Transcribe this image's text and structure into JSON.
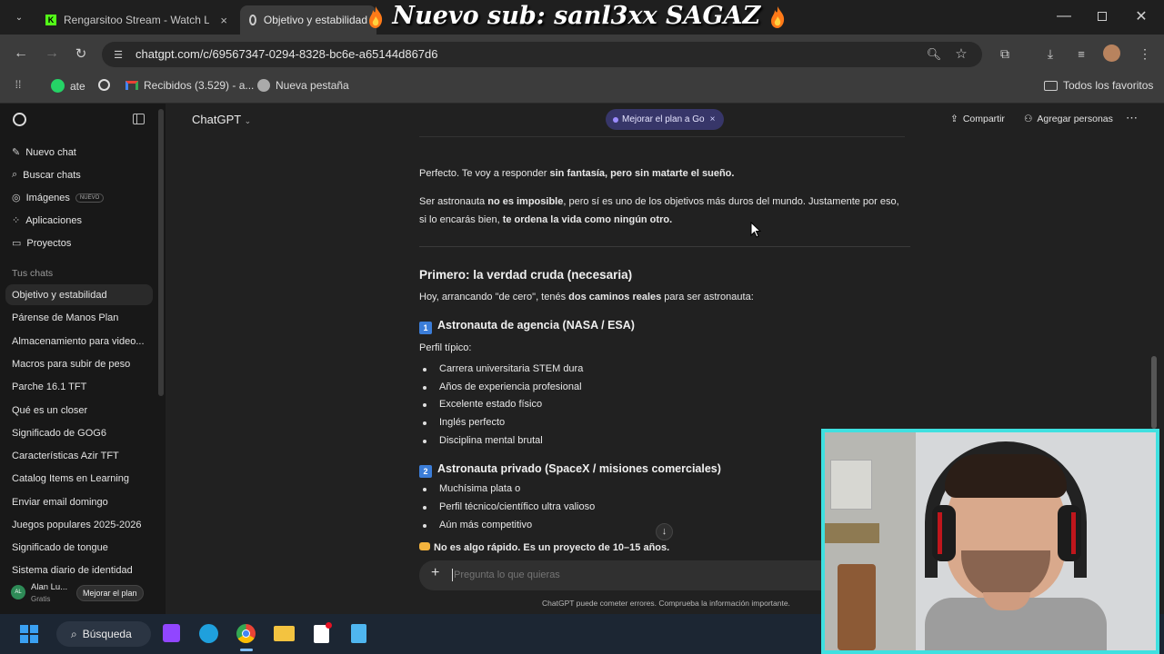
{
  "browser": {
    "tabs": [
      {
        "title": "Rengarsitoo Stream - Watch Liv",
        "close": "×"
      },
      {
        "title": "Objetivo y estabilidad",
        "close": ""
      }
    ],
    "url": "chatgpt.com/c/69567347-0294-8328-bc6e-a65144d867d6",
    "bookmarks": [
      {
        "label": "ate",
        "icon": "whatsapp-icon"
      },
      {
        "label": "",
        "icon": "chatgpt-icon"
      },
      {
        "label": "Recibidos (3.529) - a...",
        "icon": "gmail-icon"
      },
      {
        "label": "Nueva pestaña",
        "icon": "globe-icon"
      }
    ],
    "all_bookmarks": "Todos los favoritos"
  },
  "overlay": {
    "text": "Nuevo sub: sanl3xx SAGAZ"
  },
  "sidebar": {
    "items": [
      {
        "label": "Nuevo chat",
        "icon": "edit-icon"
      },
      {
        "label": "Buscar chats",
        "icon": "search-icon"
      },
      {
        "label": "Imágenes",
        "icon": "image-icon",
        "badge": "NUEVO"
      },
      {
        "label": "Aplicaciones",
        "icon": "apps-icon"
      },
      {
        "label": "Proyectos",
        "icon": "folder-icon"
      }
    ],
    "section_title": "Tus chats",
    "chats": [
      "Objetivo y estabilidad",
      "Párense de Manos Plan",
      "Almacenamiento para video...",
      "Macros para subir de peso",
      "Parche 16.1 TFT",
      "Qué es un closer",
      "Significado de GOG6",
      "Características Azir TFT",
      "Catalog Items en Learning",
      "Enviar email domingo",
      "Juegos populares 2025-2026",
      "Significado de tongue",
      "Sistema diario de identidad"
    ],
    "user": {
      "initials": "AL",
      "name": "Alan Lu...",
      "plan": "Gratis",
      "upgrade": "Mejorar el plan"
    }
  },
  "header": {
    "model": "ChatGPT",
    "promo": "Mejorar el plan a Go",
    "share": "Compartir",
    "add_people": "Agregar personas"
  },
  "message": {
    "p1_a": "Perfecto. Te voy a responder ",
    "p1_b": "sin fantasía, pero sin matarte el sueño.",
    "p2_a": "Ser astronauta ",
    "p2_b": "no es imposible",
    "p2_c": ", pero sí es uno de los objetivos más duros del mundo. Justamente por eso,",
    "p2_d": "si lo encarás bien, ",
    "p2_e": "te ordena la vida como ningún otro.",
    "h1": "Primero: la verdad cruda (necesaria)",
    "p3_a": "Hoy, arrancando \"de cero\", tenés ",
    "p3_b": "dos caminos reales",
    "p3_c": " para ser astronauta:",
    "opt1_num": "1",
    "opt1_title": "Astronauta de agencia (NASA / ESA)",
    "profile_label": "Perfil típico:",
    "list1": [
      "Carrera universitaria STEM dura",
      "Años de experiencia profesional",
      "Excelente estado físico",
      "Inglés perfecto",
      "Disciplina mental brutal"
    ],
    "opt2_num": "2",
    "opt2_title": "Astronauta privado (SpaceX / misiones comerciales)",
    "list2": [
      "Muchísima plata o",
      "Perfil técnico/científico ultra valioso",
      "Aún más competitivo"
    ],
    "conclusion": "No es algo rápido. Es un proyecto de 10–15 años."
  },
  "composer": {
    "placeholder": "Pregunta lo que quieras",
    "disclaimer": "ChatGPT puede cometer errores. Comprueba la información importante."
  },
  "taskbar": {
    "search": "Búsqueda"
  }
}
